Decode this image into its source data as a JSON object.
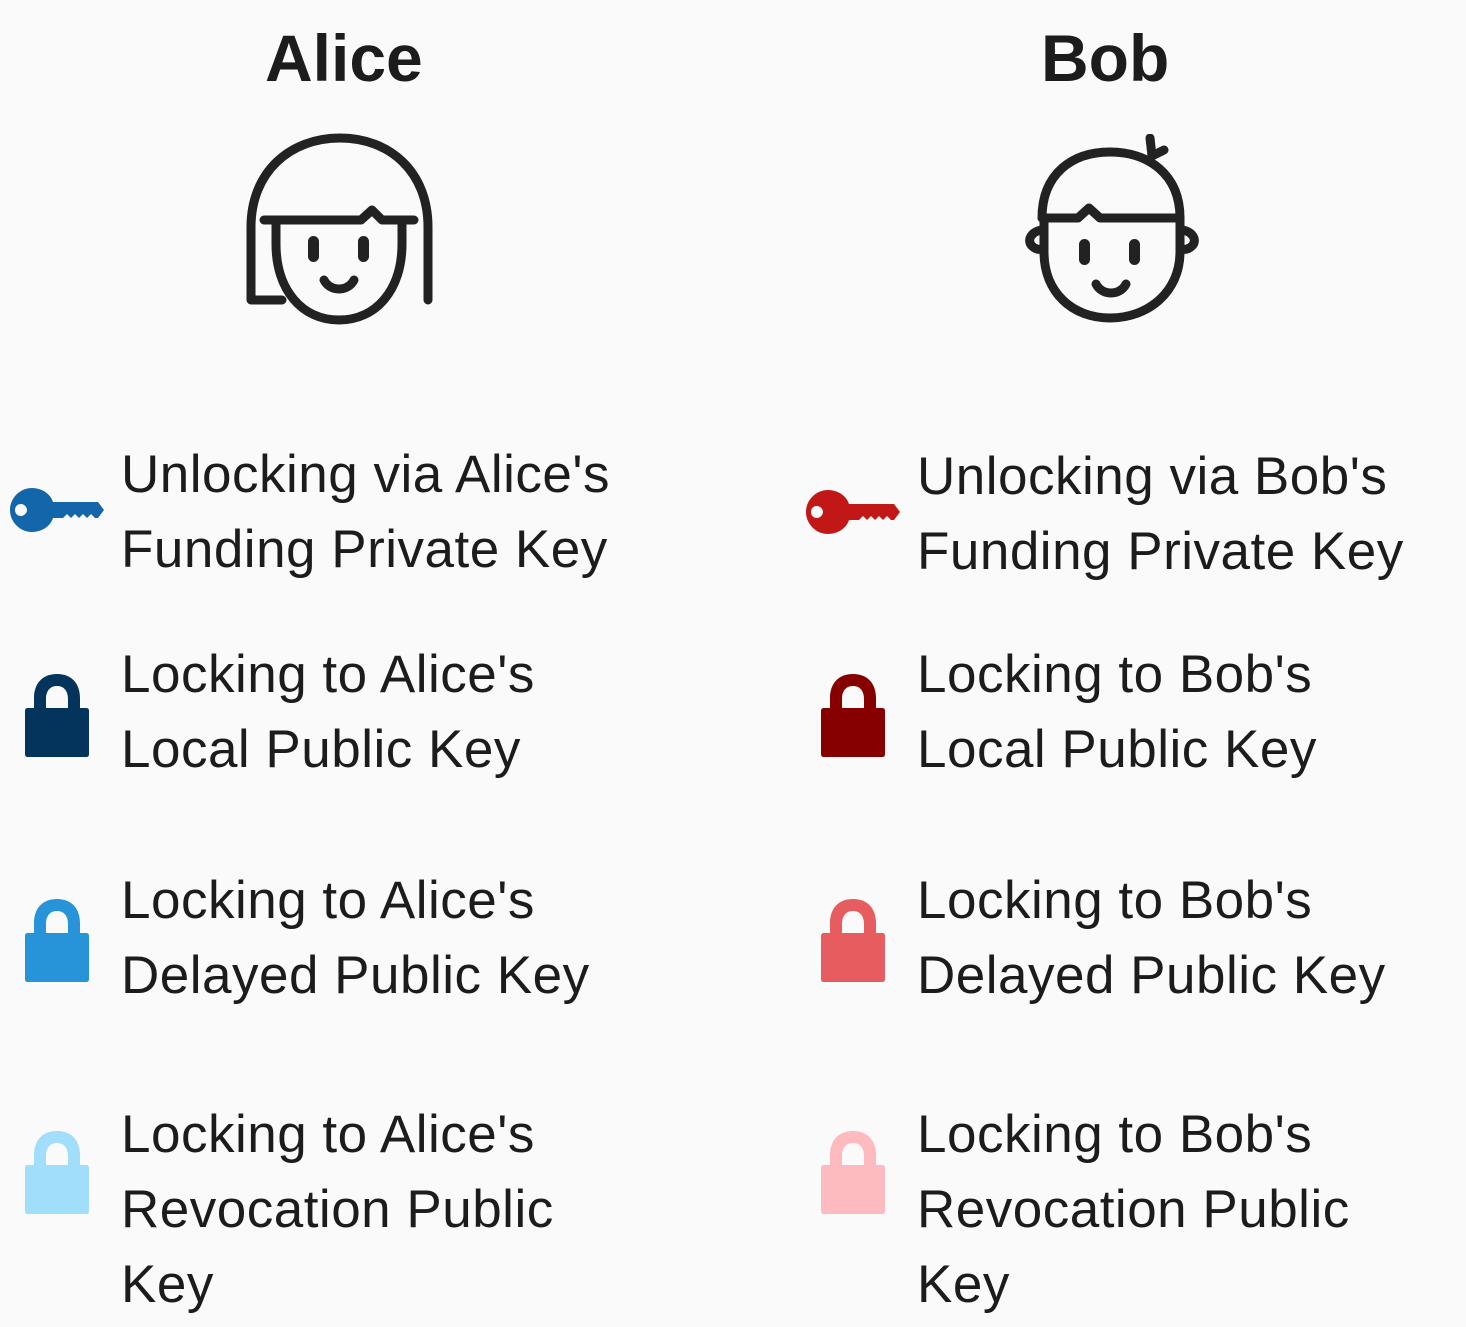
{
  "people": [
    {
      "id": "alice",
      "name": "Alice",
      "items": [
        {
          "icon": "key-icon",
          "color": "#1366a9",
          "lines": [
            "Unlocking via Alice's",
            "Funding Private Key"
          ]
        },
        {
          "icon": "lock-icon",
          "color": "#04345c",
          "lines": [
            "Locking to Alice's",
            "Local Public Key"
          ]
        },
        {
          "icon": "lock-icon",
          "color": "#2794d9",
          "lines": [
            "Locking to Alice's",
            "Delayed Public Key"
          ]
        },
        {
          "icon": "lock-icon",
          "color": "#a0defb",
          "lines": [
            "Locking to Alice's",
            "Revocation Public",
            "Key"
          ]
        }
      ]
    },
    {
      "id": "bob",
      "name": "Bob",
      "items": [
        {
          "icon": "key-icon",
          "color": "#c21717",
          "lines": [
            "Unlocking via Bob's",
            "Funding Private Key"
          ]
        },
        {
          "icon": "lock-icon",
          "color": "#870000",
          "lines": [
            "Locking to Bob's",
            "Local Public Key"
          ]
        },
        {
          "icon": "lock-icon",
          "color": "#e75c5f",
          "lines": [
            "Locking to Bob's",
            "Delayed Public Key"
          ]
        },
        {
          "icon": "lock-icon",
          "color": "#fdbbbf",
          "lines": [
            "Locking to Bob's",
            "Revocation Public",
            "Key"
          ]
        }
      ]
    }
  ]
}
